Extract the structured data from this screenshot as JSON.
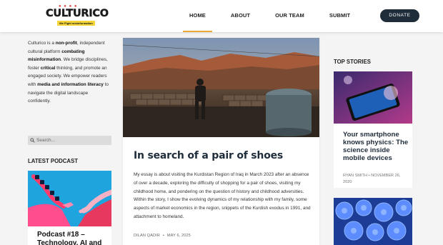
{
  "brand": {
    "name": "CULTURICO",
    "tagline": "We Fight misinformation",
    "accent": "#e8a838",
    "dark": "#1f2c3a"
  },
  "nav": {
    "items": [
      "HOME",
      "ABOUT",
      "OUR TEAM",
      "SUBMIT"
    ],
    "active": "HOME",
    "donate": "DONATE"
  },
  "about": {
    "p1": "Culturico is a ",
    "b1": "non-profit",
    "p2": ", independent cultural platform ",
    "b2": "combating misinformation",
    "p3": ". We bridge disciplines, foster ",
    "b3": "critical",
    "p4": " thinking, and promote an engaged society. We empower readers with ",
    "b4": "media and information literacy",
    "p5": " to navigate the digital landscape confidently."
  },
  "search": {
    "placeholder": "Search...",
    "icon": "search-icon"
  },
  "latest_podcast": {
    "heading": "LATEST PODCAST",
    "title": "Podcast #18 – Technology, AI and"
  },
  "main_post": {
    "title": "In search of a pair of shoes",
    "excerpt": "My essay is about visiting the Kurdistan Region of Iraq in March 2023 after an absence of over a decade, exploring the difficulty of shopping for a pair of shoes, visiting my childhood home, and pondering on the question of history and childhood adversities. Within the story, I show the evolving dynamics of my relationship with my family, some aspects of market economics in the region, snippets of the Kurdish exodus in 1991, and attachment to homeland.",
    "author": "DILAN QADIR",
    "separator": "•",
    "date": "MAY 6, 2025"
  },
  "top_stories": {
    "heading": "TOP STORIES",
    "items": [
      {
        "title": "Your smartphone knows physics: The science inside mobile devices",
        "author": "RYAN SMITH",
        "separator": "•",
        "date": "NOVEMBER 26, 2020"
      }
    ]
  }
}
